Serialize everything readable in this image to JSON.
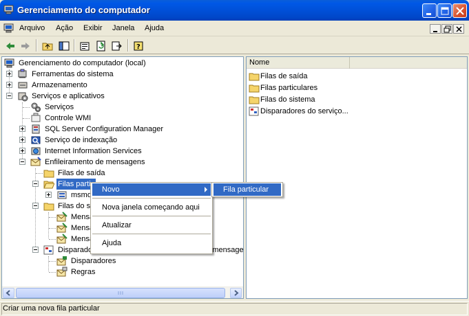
{
  "window": {
    "title": "Gerenciamento do computador"
  },
  "menu": [
    "Arquivo",
    "Ação",
    "Exibir",
    "Janela",
    "Ajuda"
  ],
  "tree": {
    "root": "Gerenciamento do computador (local)",
    "items": [
      "Ferramentas do sistema",
      "Armazenamento",
      "Serviços e aplicativos",
      "Serviços",
      "Controle WMI",
      "SQL Server Configuration Manager",
      "Serviço de indexação",
      "Internet Information Services",
      "Enfileiramento de mensagens",
      "Filas de saída",
      "Filas particulares",
      "msmq",
      "Filas do sistema",
      "Mensagens de diário",
      "Mensagens mortas",
      "Mensagens mortas transacionais",
      "Disparadores do serviço de enfileiramento de mensagens",
      "Disparadores",
      "Regras"
    ],
    "visible_labels": {
      "filas_particulares": "Filas partic",
      "msmq": "msmq",
      "filas_do_sistema": "Filas do si",
      "mensagens_1": "Mensa",
      "mensagens_2": "Mensa",
      "mensagens_3": "Mensa",
      "disparadores_servico": "Disparadores do serviço de enfileiramento de mensagen"
    }
  },
  "list": {
    "column_name": "Nome",
    "items": [
      "Filas de saída",
      "Filas particulares",
      "Filas do sistema",
      "Disparadores do serviço..."
    ]
  },
  "context_menu": {
    "items": [
      "Novo",
      "Nova janela começando aqui",
      "Atualizar",
      "Ajuda"
    ]
  },
  "submenu": {
    "items": [
      "Fila particular"
    ]
  },
  "status": {
    "text": "Criar uma nova fila particular"
  },
  "colors": {
    "selection": "#316AC5",
    "titlebar": "#0058E6"
  }
}
